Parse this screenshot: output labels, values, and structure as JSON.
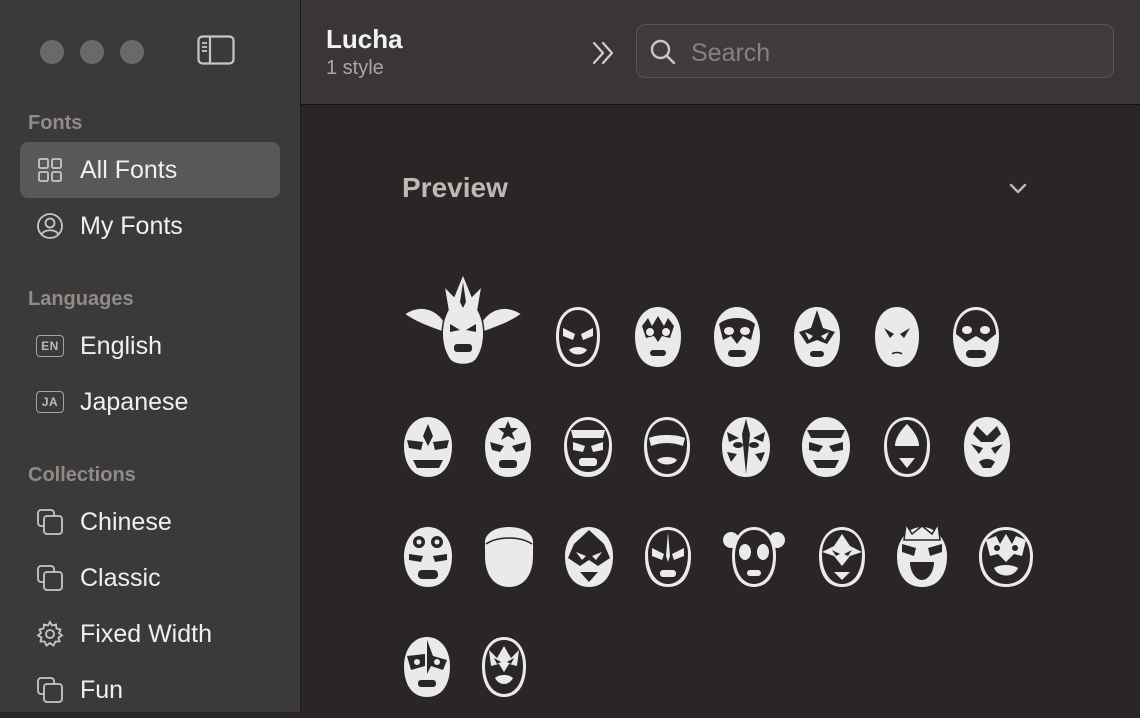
{
  "window": {
    "traffic_lights": [
      "close",
      "minimize",
      "zoom"
    ],
    "sidebar_toggle_icon": "sidebar-left-icon"
  },
  "sidebar": {
    "sections": [
      {
        "label": "Fonts",
        "items": [
          {
            "label": "All Fonts",
            "icon": "grid-icon",
            "selected": true
          },
          {
            "label": "My Fonts",
            "icon": "person-circle-icon",
            "selected": false
          }
        ]
      },
      {
        "label": "Languages",
        "items": [
          {
            "label": "English",
            "icon": "EN"
          },
          {
            "label": "Japanese",
            "icon": "JA"
          }
        ]
      },
      {
        "label": "Collections",
        "items": [
          {
            "label": "Chinese",
            "icon": "collection-icon"
          },
          {
            "label": "Classic",
            "icon": "collection-icon"
          },
          {
            "label": "Fixed Width",
            "icon": "gear-icon"
          },
          {
            "label": "Fun",
            "icon": "collection-icon"
          }
        ]
      }
    ]
  },
  "header": {
    "title": "Lucha",
    "subtitle": "1 style",
    "expand_icon": "chevron-double-right-icon"
  },
  "search": {
    "placeholder": "Search"
  },
  "preview": {
    "title": "Preview",
    "collapse_icon": "chevron-down-icon",
    "glyph_rows": [
      8,
      8,
      8,
      2
    ]
  },
  "colors": {
    "sidebar_bg": "#3c3a39",
    "selected_bg": "#5a5856",
    "content_bg": "#2a2625",
    "glyph_fill": "#eaeaea"
  }
}
